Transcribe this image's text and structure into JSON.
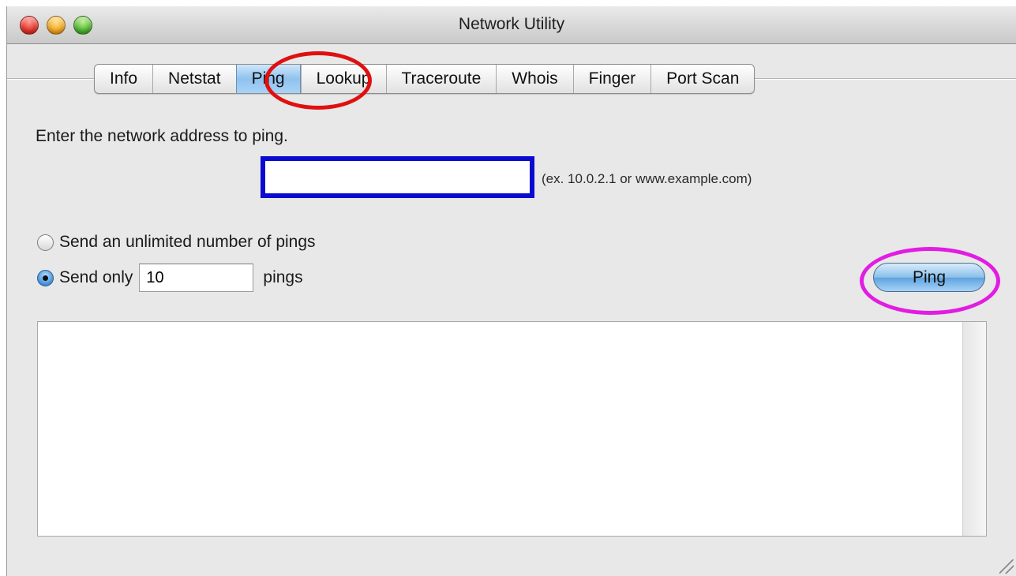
{
  "window": {
    "title": "Network Utility"
  },
  "tabs": [
    {
      "label": "Info",
      "selected": false
    },
    {
      "label": "Netstat",
      "selected": false
    },
    {
      "label": "Ping",
      "selected": true
    },
    {
      "label": "Lookup",
      "selected": false
    },
    {
      "label": "Traceroute",
      "selected": false
    },
    {
      "label": "Whois",
      "selected": false
    },
    {
      "label": "Finger",
      "selected": false
    },
    {
      "label": "Port Scan",
      "selected": false
    }
  ],
  "ping": {
    "prompt": "Enter the network address to ping.",
    "address_value": "",
    "address_hint": "(ex. 10.0.2.1 or www.example.com)",
    "unlimited_label": "Send an unlimited number of pings",
    "send_only_label": "Send only",
    "count_value": "10",
    "pings_suffix": "pings",
    "selected_option": "send_only",
    "button_label": "Ping"
  },
  "annotations": {
    "tab_highlight_color": "#e01010",
    "button_highlight_color": "#e21ce2",
    "input_highlight_color": "#0a0ad0"
  }
}
